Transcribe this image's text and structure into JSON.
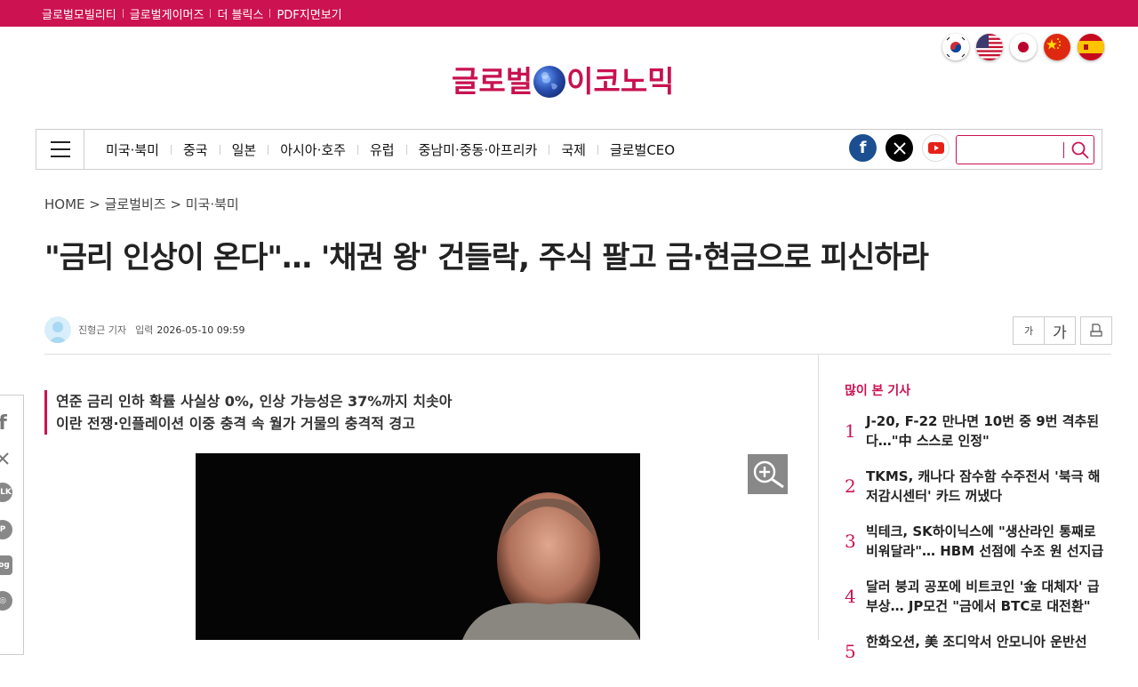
{
  "topbar": {
    "links": [
      "글로벌모빌리티",
      "글로벌게이머즈",
      "더 블릭스",
      "PDF지면보기"
    ]
  },
  "flags": [
    "korea-flag",
    "usa-flag",
    "japan-flag",
    "china-flag",
    "spain-flag"
  ],
  "logo": {
    "left": "글로벌",
    "right": "이코노믹"
  },
  "nav": {
    "items": [
      "미국·북미",
      "중국",
      "일본",
      "아시아·호주",
      "유럽",
      "중남미·중동·아프리카",
      "국제",
      "글로벌CEO"
    ],
    "social": [
      "facebook-icon",
      "x-icon",
      "youtube-icon"
    ],
    "search_placeholder": ""
  },
  "breadcrumb": "HOME > 글로벌비즈 > 미국·북미",
  "article": {
    "headline": "\"금리 인상이 온다\"… '채권 왕' 건들락, 주식 팔고 금·현금으로 피신하라",
    "reporter": "진형근 기자",
    "input_label": "입력",
    "date": "2026-05-10 09:59",
    "font_small": "가",
    "font_large": "가",
    "summary": [
      "연준 금리 인하 확률 사실상 0%, 인상 가능성은 37%까지 치솟아",
      "이란 전쟁·인플레이션 이중 충격 속 월가 거물의 충격적 경고"
    ]
  },
  "share_icons": [
    "facebook-icon",
    "x-icon",
    "kakaotalk-icon",
    "pinterest-icon",
    "blog-icon",
    "band-icon"
  ],
  "popular": {
    "title": "많이 본 기사",
    "items": [
      {
        "num": "1",
        "text": "J-20, F-22 만나면 10번 중 9번 격추된다…\"中 스스로 인정\""
      },
      {
        "num": "2",
        "text": "TKMS, 캐나다 잠수함 수주전서 '북극 해저감시센터' 카드 꺼냈다"
      },
      {
        "num": "3",
        "text": "빅테크, SK하이닉스에 \"생산라인 통째로 비워달라\"… HBM 선점에 수조 원 선지급"
      },
      {
        "num": "4",
        "text": "달러 붕괴 공포에 비트코인 '金 대체자' 급부상… JP모건 \"금에서 BTC로 대전환\""
      },
      {
        "num": "5",
        "text": "한화오션, 美 조디악서 안모니아 운반선"
      }
    ]
  },
  "colors": {
    "brand": "#cc1250"
  }
}
